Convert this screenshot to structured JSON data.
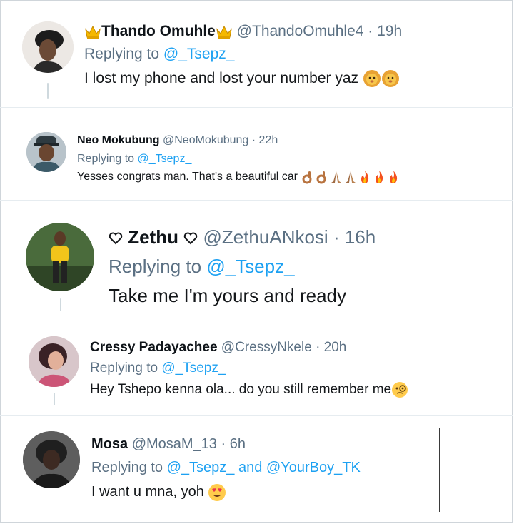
{
  "replies": [
    {
      "name": "Thando Omuhle",
      "handle": "@ThandoOmuhle4",
      "time": "19h",
      "replying_prefix": "Replying to",
      "replying_to": "@_Tsepz_",
      "text": "I lost my phone and lost your number yaz",
      "name_icons": [
        "crown-icon",
        "crown-icon"
      ],
      "text_icons": [
        "lion-face-emoji",
        "lion-face-emoji"
      ]
    },
    {
      "name": "Neo Mokubung",
      "handle": "@NeoMokubung",
      "time": "22h",
      "replying_prefix": "Replying to",
      "replying_to": "@_Tsepz_",
      "text": "Yesses congrats man. That's a beautiful car",
      "text_icons": [
        "ok-hand-emoji",
        "ok-hand-emoji",
        "praying-hands-emoji",
        "praying-hands-emoji",
        "fire-emoji",
        "fire-emoji",
        "fire-emoji"
      ]
    },
    {
      "name": "Zethu",
      "handle": "@ZethuANkosi",
      "time": "16h",
      "replying_prefix": "Replying to",
      "replying_to": "@_Tsepz_",
      "text": "Take me I'm yours and ready",
      "name_icons": [
        "heart-outline-icon",
        "heart-outline-icon"
      ]
    },
    {
      "name": "Cressy Padayachee",
      "handle": "@CressyNkele",
      "time": "20h",
      "replying_prefix": "Replying to",
      "replying_to": "@_Tsepz_",
      "text": "Hey Tshepo kenna ola... do you still remember me",
      "text_icons": [
        "monocle-face-emoji"
      ]
    },
    {
      "name": "Mosa",
      "handle": "@MosaM_13",
      "time": "6h",
      "replying_prefix": "Replying to",
      "replying_to": "@_Tsepz_",
      "replying_and": "and",
      "replying_to_2": "@YourBoy_TK",
      "text": "I want u mna, yoh",
      "text_icons": [
        "heart-eyes-emoji"
      ]
    }
  ],
  "separator": "·",
  "colors": {
    "name": "#0f1419",
    "secondary": "#5b7083",
    "link": "#1da1f2",
    "thread_line": "#cfd9de"
  }
}
